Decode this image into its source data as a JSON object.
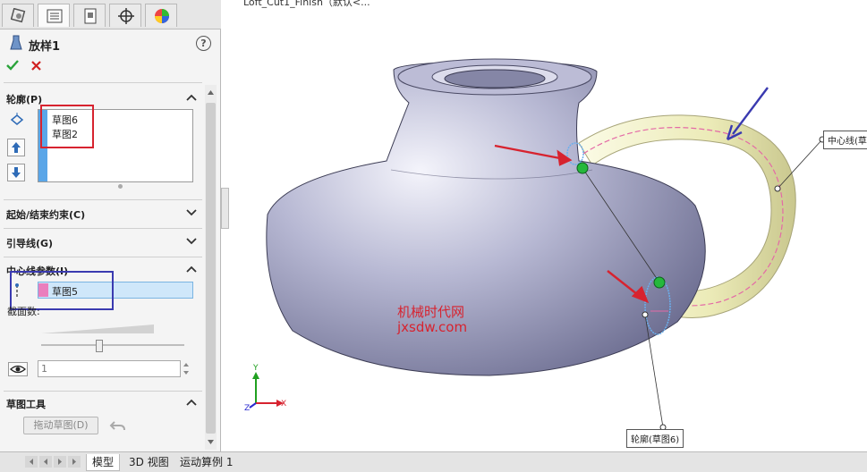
{
  "viewport": {
    "title": "Loft_Cut1_Finish（默认<..."
  },
  "feature": {
    "title": "放样1",
    "help_glyph": "?"
  },
  "sections": {
    "profiles": {
      "title": "轮廓(P)",
      "items": [
        "草图6",
        "草图2"
      ]
    },
    "start_end": {
      "title": "起始/结束约束(C)"
    },
    "guides": {
      "title": "引导线(G)"
    },
    "centerline": {
      "title": "中心线参数(I)",
      "value": "草图5",
      "sections_label": "截面数:"
    },
    "spin_value": "1",
    "sketch_tools": {
      "title": "草图工具",
      "drag_button": "拖动草图(D)"
    }
  },
  "bottom_tabs": [
    "模型",
    "3D 视图",
    "运动算例 1"
  ],
  "callouts": {
    "centerline": "中心线(草",
    "profile": "轮廓(草图6)"
  },
  "watermark": {
    "line1": "机械时代网",
    "line2": "jxsdw.com"
  },
  "triad": {
    "y": "Y",
    "x": "X",
    "z": "Z"
  },
  "colors": {
    "annotation_red": "#d7232f",
    "annotation_blue": "#3a3ab0",
    "selection_blue": "#cfe7fa"
  }
}
